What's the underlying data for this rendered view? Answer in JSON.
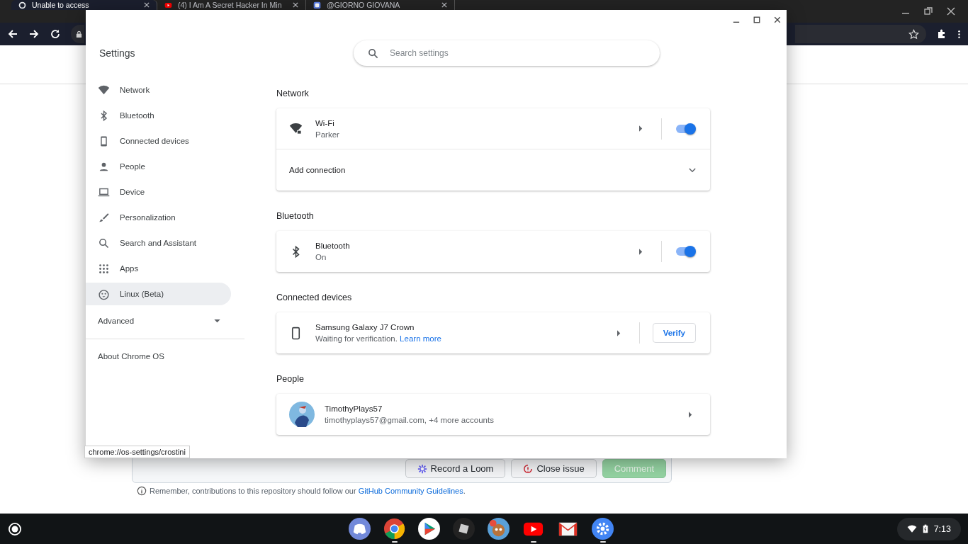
{
  "browser": {
    "tabs": [
      {
        "title": "Unable to access",
        "kind": "github",
        "selected": true
      },
      {
        "title": "(4) I Am A Secret Hacker In Min",
        "kind": "youtube",
        "selected": false
      },
      {
        "title": "@GIORNO GIOVANA",
        "kind": "site",
        "selected": false
      }
    ]
  },
  "page": {
    "buttons": [
      {
        "label": "Record a Loom",
        "kind": "loom",
        "disabled": false
      },
      {
        "label": "Close issue",
        "kind": "close",
        "disabled": false
      },
      {
        "label": "Comment",
        "kind": "plain",
        "disabled": true
      }
    ],
    "notice": {
      "text": "Remember, contributions to this repository should follow our",
      "link": "GitHub Community Guidelines",
      "end": "."
    }
  },
  "settings": {
    "title": "Settings",
    "search": {
      "placeholder": "Search settings"
    },
    "sidebar": {
      "items": [
        {
          "label": "Network",
          "kind": "wifi",
          "selected": false
        },
        {
          "label": "Bluetooth",
          "kind": "bluetooth",
          "selected": false
        },
        {
          "label": "Connected devices",
          "kind": "phone",
          "selected": false
        },
        {
          "label": "People",
          "kind": "person",
          "selected": false
        },
        {
          "label": "Device",
          "kind": "laptop",
          "selected": false
        },
        {
          "label": "Personalization",
          "kind": "brush",
          "selected": false
        },
        {
          "label": "Search and Assistant",
          "kind": "search",
          "selected": false
        },
        {
          "label": "Apps",
          "kind": "apps",
          "selected": false
        },
        {
          "label": "Linux (Beta)",
          "kind": "linux",
          "selected": true
        }
      ],
      "advanced": {
        "label": "Advanced",
        "expanded": false
      },
      "about": "About Chrome OS"
    },
    "sections": [
      {
        "heading": "Network",
        "rows": [
          {
            "kind": "wifi",
            "title": "Wi-Fi",
            "subtitle": "Parker",
            "on": true
          },
          {
            "kind": "expand",
            "title": "Add connection",
            "expanded": false
          }
        ]
      },
      {
        "heading": "Bluetooth",
        "rows": [
          {
            "kind": "bluetooth",
            "title": "Bluetooth",
            "subtitle": "On",
            "on": true
          }
        ]
      },
      {
        "heading": "Connected devices",
        "rows": [
          {
            "kind": "phone",
            "title": "Samsung Galaxy J7 Crown",
            "subtitle": "Waiting for verification.",
            "link": "Learn more",
            "button": "Verify"
          }
        ]
      },
      {
        "heading": "People",
        "rows": [
          {
            "kind": "account",
            "title": "TimothyPlays57",
            "subtitle": "timothyplays57@gmail.com, +4 more accounts"
          }
        ]
      }
    ]
  },
  "status_url": "chrome://os-settings/crostini",
  "taskbar": {
    "apps": [
      {
        "kind": "discord",
        "running": false
      },
      {
        "kind": "chrome",
        "running": true
      },
      {
        "kind": "play",
        "running": false
      },
      {
        "kind": "roblox",
        "running": false
      },
      {
        "kind": "game",
        "running": false
      },
      {
        "kind": "youtube",
        "running": true
      },
      {
        "kind": "gmail",
        "running": false
      },
      {
        "kind": "settings",
        "running": true
      }
    ],
    "time": "7:13"
  }
}
